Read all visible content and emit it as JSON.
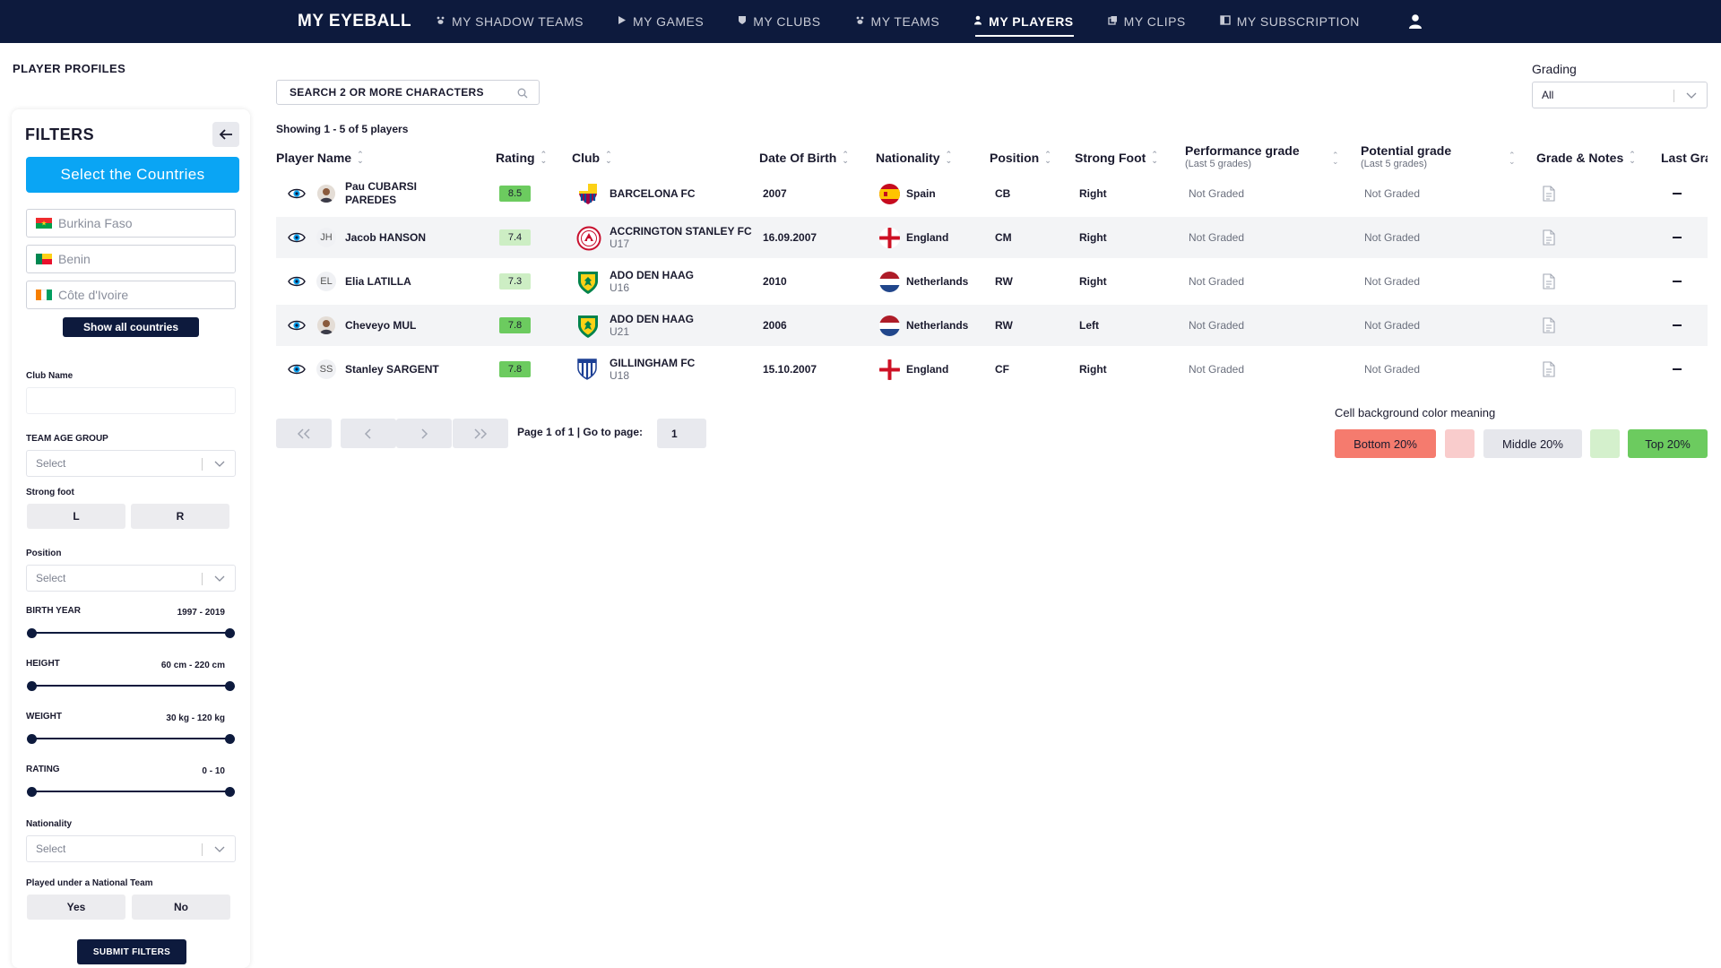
{
  "brand": "MY EYEBALL",
  "nav": [
    {
      "label": "MY SHADOW TEAMS",
      "icon": "paw"
    },
    {
      "label": "MY GAMES",
      "icon": "play"
    },
    {
      "label": "MY CLUBS",
      "icon": "shield"
    },
    {
      "label": "MY TEAMS",
      "icon": "paw"
    },
    {
      "label": "MY PLAYERS",
      "icon": "person",
      "active": true
    },
    {
      "label": "MY CLIPS",
      "icon": "clip"
    },
    {
      "label": "MY SUBSCRIPTION",
      "icon": "card"
    }
  ],
  "page_title": "PLAYER PROFILES",
  "filters": {
    "title": "FILTERS",
    "countries_button": "Select the Countries",
    "countries": [
      {
        "name": "Burkina Faso",
        "flag_colors": [
          "#ef2b2d",
          "#009e49"
        ]
      },
      {
        "name": "Benin",
        "flag_colors": [
          "#008751",
          "#fcd116",
          "#e8112d"
        ]
      },
      {
        "name": "Côte d'Ivoire",
        "flag_colors": [
          "#f77f00",
          "#ffffff",
          "#009e60"
        ]
      }
    ],
    "show_all": "Show all countries",
    "club_name_label": "Club Name",
    "team_age_label": "TEAM AGE GROUP",
    "select_placeholder": "Select",
    "strong_foot_label": "Strong foot",
    "foot_left": "L",
    "foot_right": "R",
    "position_label": "Position",
    "birth_year_label": "BIRTH YEAR",
    "birth_year_value": "1997 - 2019",
    "height_label": "HEIGHT",
    "height_value": "60 cm - 220 cm",
    "weight_label": "WEIGHT",
    "weight_value": "30 kg - 120 kg",
    "rating_label": "RATING",
    "rating_value": "0 - 10",
    "nationality_label": "Nationality",
    "national_team_label": "Played under a National Team",
    "yes": "Yes",
    "no": "No",
    "submit": "SUBMIT FILTERS"
  },
  "search": {
    "placeholder": "SEARCH 2 OR MORE CHARACTERS"
  },
  "showing": "Showing 1 - 5 of 5 players",
  "grading": {
    "label": "Grading",
    "value": "All"
  },
  "columns": {
    "player_name": "Player Name",
    "rating": "Rating",
    "club": "Club",
    "dob": "Date Of Birth",
    "nationality": "Nationality",
    "position": "Position",
    "strong_foot": "Strong Foot",
    "performance": "Performance grade",
    "performance_sub": "(Last 5 grades)",
    "potential": "Potential grade",
    "potential_sub": "(Last 5 grades)",
    "grade_notes": "Grade & Notes",
    "last_grade": "Last Gra"
  },
  "players": [
    {
      "name_line1": "Pau CUBARSI",
      "name_line2": "PAREDES",
      "initials": "",
      "rating": "8.5",
      "rating_color": "#6ccb5f",
      "club": "BARCELONA FC",
      "club_sub": "",
      "dob": "2007",
      "nationality": "Spain",
      "position": "CB",
      "foot": "Right",
      "performance": "Not Graded",
      "potential": "Not Graded"
    },
    {
      "name_line1": "Jacob HANSON",
      "name_line2": "",
      "initials": "JH",
      "rating": "7.4",
      "rating_color": "#cdeec4",
      "club": "ACCRINGTON STANLEY FC",
      "club_sub": "U17",
      "dob": "16.09.2007",
      "nationality": "England",
      "position": "CM",
      "foot": "Right",
      "performance": "Not Graded",
      "potential": "Not Graded"
    },
    {
      "name_line1": "Elia LATILLA",
      "name_line2": "",
      "initials": "EL",
      "rating": "7.3",
      "rating_color": "#cdeec4",
      "club": "ADO DEN HAAG",
      "club_sub": "U16",
      "dob": "2010",
      "nationality": "Netherlands",
      "position": "RW",
      "foot": "Right",
      "performance": "Not Graded",
      "potential": "Not Graded"
    },
    {
      "name_line1": "Cheveyo MUL",
      "name_line2": "",
      "initials": "",
      "rating": "7.8",
      "rating_color": "#6ccb5f",
      "club": "ADO DEN HAAG",
      "club_sub": "U21",
      "dob": "2006",
      "nationality": "Netherlands",
      "position": "RW",
      "foot": "Left",
      "performance": "Not Graded",
      "potential": "Not Graded"
    },
    {
      "name_line1": "Stanley SARGENT",
      "name_line2": "",
      "initials": "SS",
      "rating": "7.8",
      "rating_color": "#6ccb5f",
      "club": "GILLINGHAM FC",
      "club_sub": "U18",
      "dob": "15.10.2007",
      "nationality": "England",
      "position": "CF",
      "foot": "Right",
      "performance": "Not Graded",
      "potential": "Not Graded"
    }
  ],
  "pagination": {
    "info": "Page 1 of 1 | Go to page:",
    "page": "1"
  },
  "legend": {
    "title": "Cell background color meaning",
    "bottom": "Bottom 20%",
    "middle": "Middle 20%",
    "top": "Top 20%",
    "colors": {
      "bottom": "#f57b6e",
      "lower": "#f9cccc",
      "middle": "#e6e7ec",
      "upper": "#d4f0cc",
      "top": "#6ccb5f"
    }
  }
}
